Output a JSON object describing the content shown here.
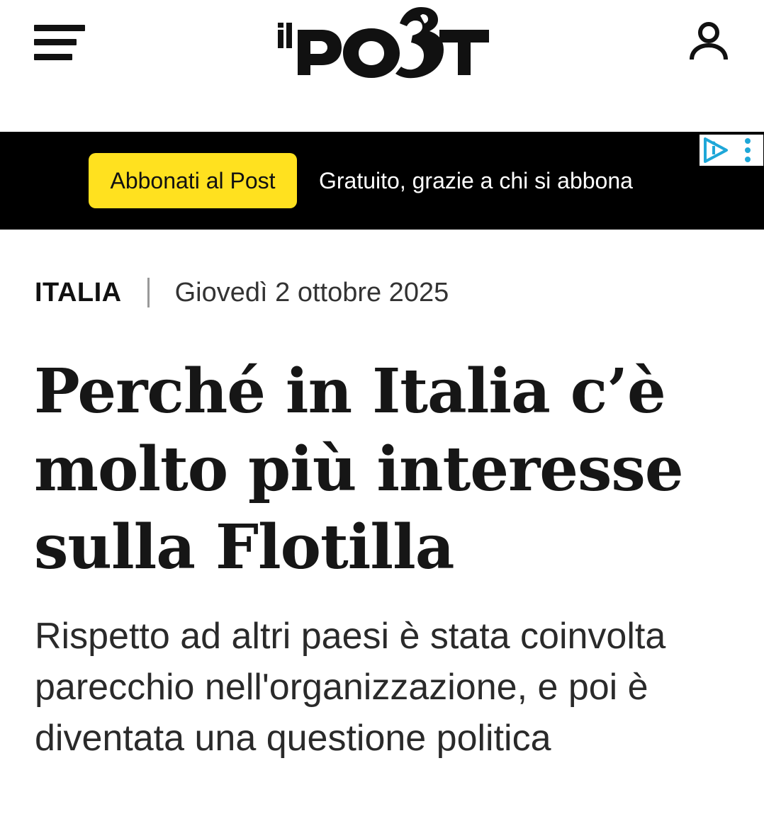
{
  "header": {
    "menu_icon": "hamburger-menu-icon",
    "logo_text": "il POST",
    "account_icon": "user-icon"
  },
  "banner": {
    "subscribe_label": "Abbonati al Post",
    "tagline": "Gratuito, grazie a chi si abbona",
    "ad_icon": "adchoices-icon",
    "accent_color": "#ffe11f"
  },
  "article": {
    "category": "ITALIA",
    "date": "Giovedì 2 ottobre 2025",
    "title": "Perché in Italia c’è molto più interesse sulla Flotilla",
    "summary": "Rispetto ad altri paesi è stata coinvolta parecchio nell'organizzazione, e poi è diventata una questione politica"
  }
}
